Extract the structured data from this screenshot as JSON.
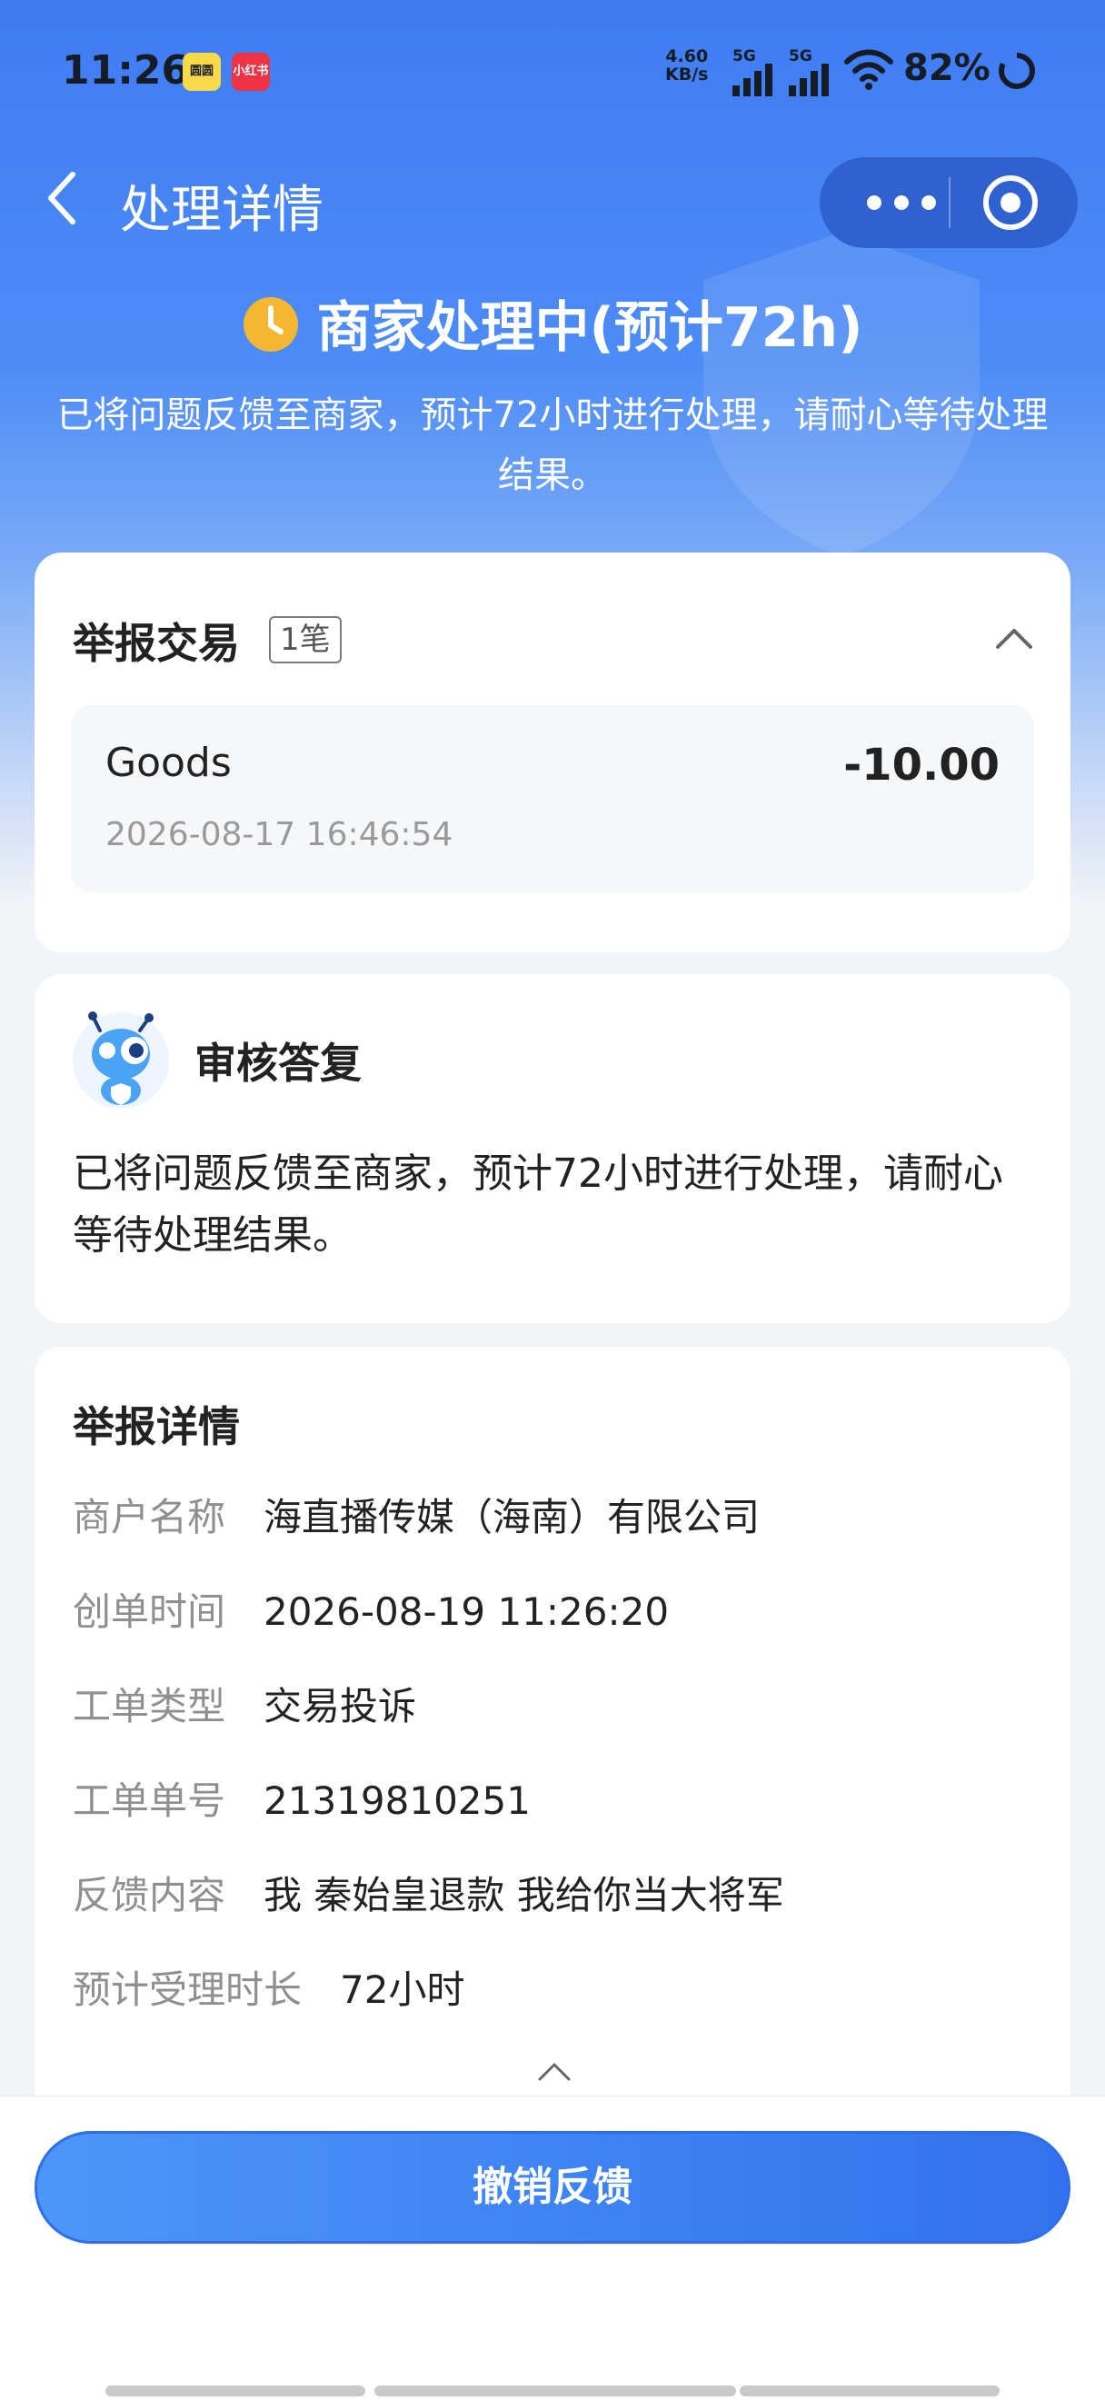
{
  "status_bar": {
    "time": "11:26",
    "app_badges": [
      "圆圆",
      "小红书"
    ],
    "net_speed_value": "4.60",
    "net_speed_unit": "KB/s",
    "signal_labels": [
      "5G",
      "5G"
    ],
    "battery": "82%"
  },
  "nav": {
    "title": "处理详情"
  },
  "status": {
    "title": "商家处理中(预计72h)",
    "description": "已将问题反馈至商家，预计72小时进行处理，请耐心等待处理结果。"
  },
  "report_trade": {
    "title": "举报交易",
    "count": "1笔",
    "item": {
      "name": "Goods",
      "amount": "-10.00",
      "time": "2026-08-17 16:46:54"
    }
  },
  "review": {
    "title": "审核答复",
    "text": "已将问题反馈至商家，预计72小时进行处理，请耐心等待处理结果。"
  },
  "details": {
    "title": "举报详情",
    "rows": [
      {
        "label": "商户名称",
        "value": "海直播传媒（海南）有限公司"
      },
      {
        "label": "创单时间",
        "value": "2026-08-19 11:26:20"
      },
      {
        "label": "工单类型",
        "value": "交易投诉"
      },
      {
        "label": "工单单号",
        "value": "21319810251"
      },
      {
        "label": "反馈内容",
        "value": "我 秦始皇退款 我给你当大将军"
      },
      {
        "label": "预计受理时长",
        "value": "72小时"
      }
    ]
  },
  "actions": {
    "cancel_label": "撤销反馈"
  },
  "colors": {
    "brand_blue": "#3f7cf3",
    "status_clock": "#f5b731"
  }
}
